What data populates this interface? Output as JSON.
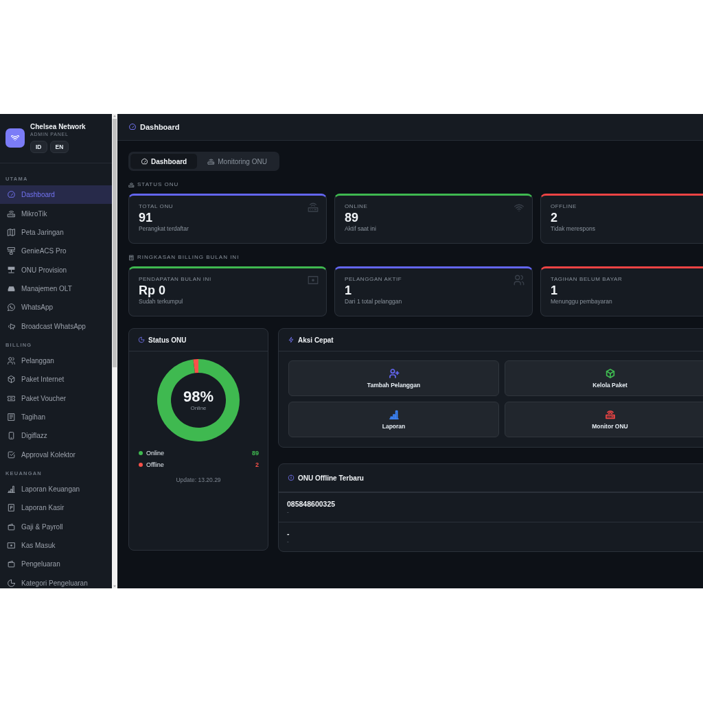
{
  "sidebar": {
    "brand": {
      "name": "Chelsea Network",
      "subtitle": "ADMIN PANEL"
    },
    "languages": [
      {
        "label": "ID"
      },
      {
        "label": "EN"
      }
    ],
    "sections": [
      {
        "title": "UTAMA",
        "items": [
          {
            "label": "Dashboard",
            "selected": true
          },
          {
            "label": "MikroTik",
            "selected": false
          },
          {
            "label": "Peta Jaringan",
            "selected": false
          },
          {
            "label": "GenieACS Pro",
            "selected": false
          },
          {
            "label": "ONU Provision",
            "selected": false
          },
          {
            "label": "Manajemen OLT",
            "selected": false
          },
          {
            "label": "WhatsApp",
            "selected": false
          },
          {
            "label": "Broadcast WhatsApp",
            "selected": false
          }
        ]
      },
      {
        "title": "BILLING",
        "items": [
          {
            "label": "Pelanggan",
            "selected": false
          },
          {
            "label": "Paket Internet",
            "selected": false
          },
          {
            "label": "Paket Voucher",
            "selected": false
          },
          {
            "label": "Tagihan",
            "selected": false
          },
          {
            "label": "Digiflazz",
            "selected": false
          },
          {
            "label": "Approval Kolektor",
            "selected": false
          }
        ]
      },
      {
        "title": "KEUANGAN",
        "items": [
          {
            "label": "Laporan Keuangan",
            "selected": false
          },
          {
            "label": "Laporan Kasir",
            "selected": false
          },
          {
            "label": "Gaji & Payroll",
            "selected": false
          },
          {
            "label": "Kas Masuk",
            "selected": false
          },
          {
            "label": "Pengeluaran",
            "selected": false
          },
          {
            "label": "Kategori Pengeluaran",
            "selected": false
          }
        ]
      }
    ]
  },
  "header": {
    "title": "Dashboard"
  },
  "tabs": [
    {
      "label": "Dashboard",
      "selected": true
    },
    {
      "label": "Monitoring ONU",
      "selected": false
    }
  ],
  "onu_status": {
    "title": "STATUS ONU",
    "cards": [
      {
        "label": "TOTAL ONU",
        "value": "91",
        "caption": "Perangkat terdaftar",
        "color": "#6366f1"
      },
      {
        "label": "ONLINE",
        "value": "89",
        "caption": "Aktif saat ini",
        "color": "#3fb950"
      },
      {
        "label": "OFFLINE",
        "value": "2",
        "caption": "Tidak merespons",
        "color": "#ef4444"
      }
    ]
  },
  "billing_summary": {
    "title": "RINGKASAN BILLING BULAN INI",
    "cards": [
      {
        "label": "PENDAPATAN BULAN INI",
        "value": "Rp 0",
        "caption": "Sudah terkumpul",
        "color": "#3fb950"
      },
      {
        "label": "PELANGGAN AKTIF",
        "value": "1",
        "caption": "Dari 1 total pelanggan",
        "color": "#6366f1"
      },
      {
        "label": "TAGIHAN BELUM BAYAR",
        "value": "1",
        "caption": "Menunggu pembayaran",
        "color": "#ef4444"
      }
    ]
  },
  "status_panel": {
    "title": "Status ONU",
    "chart_data": {
      "type": "donut",
      "categories": [
        "Online",
        "Offline"
      ],
      "values": [
        98,
        2
      ]
    },
    "center_value": "98%",
    "center_label": "Online",
    "legend": [
      {
        "value": "89",
        "color": "#3fb950"
      },
      {
        "value": "2",
        "color": "#f85149"
      }
    ],
    "updated": "Update: 13.20.29"
  },
  "quick_actions": {
    "title": "Aksi Cepat",
    "actions": [
      {
        "label": "Tambah Pelanggan",
        "color": "#6366f1"
      },
      {
        "label": "Kelola Paket",
        "color": "#3fb950"
      },
      {
        "label": "Laporan",
        "color": "#3b82f6"
      },
      {
        "label": "Monitor ONU",
        "color": "#ef4444"
      }
    ]
  },
  "offline_onus": {
    "title": "ONU Offline Terbaru",
    "rows": [
      {
        "name": "085848600325",
        "detail": "-"
      },
      {
        "name": "-",
        "detail": "-"
      }
    ]
  }
}
